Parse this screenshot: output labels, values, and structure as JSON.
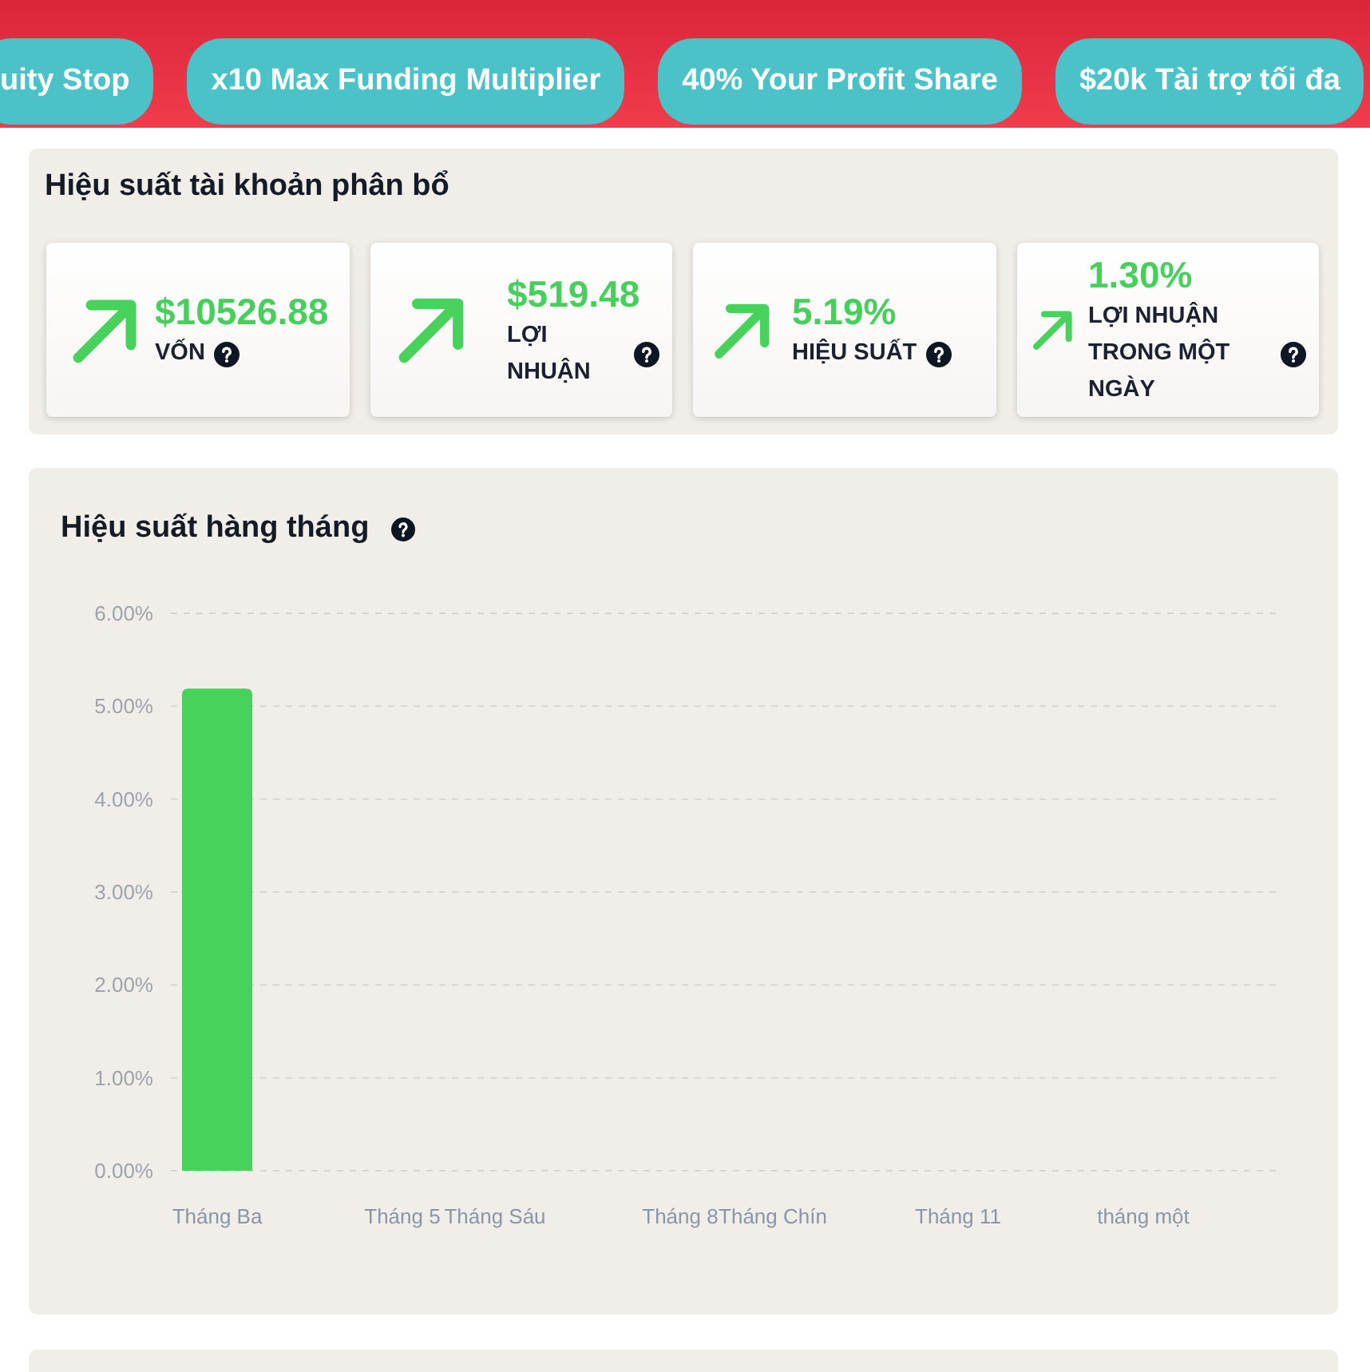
{
  "banner": {
    "pills": [
      "uity Stop",
      "x10 Max Funding Multiplier",
      "40% Your Profit Share",
      "$20k Tài trợ tối đa"
    ]
  },
  "allocation_performance": {
    "title": "Hiệu suất tài khoản phân bổ",
    "stats": [
      {
        "value": "$10526.88",
        "label": "VỐN",
        "rising": true
      },
      {
        "value": "$519.48",
        "label": "LỢI NHUẬN",
        "rising": true
      },
      {
        "value": "5.19%",
        "label": "HIỆU SUẤT",
        "rising": true
      },
      {
        "value": "1.30%",
        "label": "LỢI NHUẬN TRONG MỘT NGÀY",
        "rising": true
      }
    ]
  },
  "monthly_performance": {
    "title": "Hiệu suất hàng tháng",
    "chart_data": {
      "type": "bar",
      "grid": true,
      "categories": [
        "Tháng Ba",
        null,
        "Tháng 5",
        "Tháng Sáu",
        null,
        "Tháng 8",
        "Tháng Chín",
        null,
        "Tháng 11",
        null,
        "tháng một",
        null
      ],
      "values": [
        5.19,
        null,
        null,
        null,
        null,
        null,
        null,
        null,
        null,
        null,
        null,
        null
      ],
      "ylim": [
        0,
        6
      ],
      "yticks": [
        {
          "value": 0,
          "label": "0.00%"
        },
        {
          "value": 1,
          "label": "1.00%"
        },
        {
          "value": 2,
          "label": "2.00%"
        },
        {
          "value": 3,
          "label": "3.00%"
        },
        {
          "value": 4,
          "label": "4.00%"
        },
        {
          "value": 5,
          "label": "5.00%"
        },
        {
          "value": 6,
          "label": "6.00%"
        }
      ]
    }
  }
}
